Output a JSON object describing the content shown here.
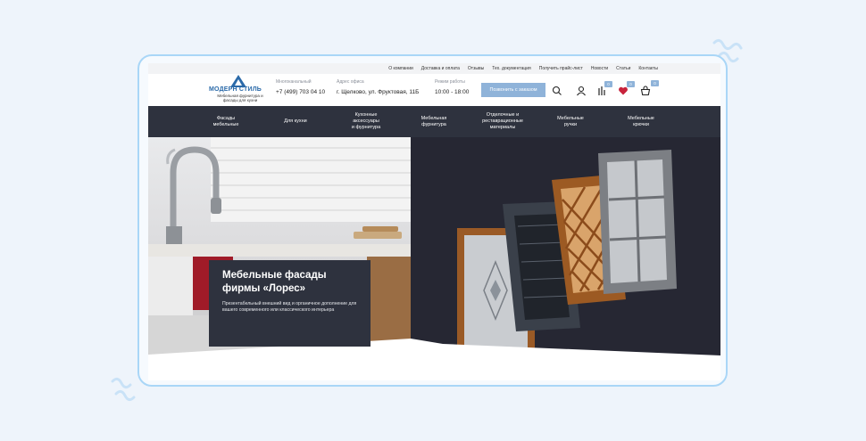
{
  "top_nav": [
    "О компании",
    "Доставка и оплата",
    "Отзывы",
    "Тех. документация",
    "Получить прайс-лист",
    "Новости",
    "Статьи",
    "Контакты"
  ],
  "logo": {
    "name": "МОДЕРН СТИЛЬ",
    "tagline": "Мебельная фурнитура и фасады для кухни"
  },
  "header": {
    "phone_label": "Многоканальный",
    "phone": "+7 (499) 703 04 10",
    "address_label": "Адрес офиса",
    "address": "г. Щелково, ул. Фруктовая, 11Б",
    "hours_label": "Режим работы",
    "hours": "10:00 - 18:00",
    "call_button": "Позвонить с заказом"
  },
  "header_icons": {
    "search": "search-icon",
    "user": "user-icon",
    "compare": "compare-icon",
    "favorite": "heart-icon",
    "cart": "cart-icon"
  },
  "badges": {
    "compare": "0",
    "favorite": "0",
    "cart": "0"
  },
  "main_nav": [
    [
      "Фасады",
      "мебельные"
    ],
    [
      "Для кухни"
    ],
    [
      "Кухонные",
      "аксессуары",
      "и фурнитура"
    ],
    [
      "Мебельная",
      "фурнитура"
    ],
    [
      "Отделочные и",
      "реставрационные",
      "материалы"
    ],
    [
      "Мебельные",
      "ручки"
    ],
    [
      "Мебельные",
      "крючки"
    ]
  ],
  "hero": {
    "title": "Мебельные фасады фирмы «Лорес»",
    "text": "Презентабельный внешний вид и органичное дополнение для вашего современного или классического интерьера"
  },
  "colors": {
    "accent": "#8fb3d9",
    "nav_bg": "#2e323e",
    "hero_dark": "#262733",
    "frame_border": "#a9d6f7",
    "heart": "#c8233c"
  }
}
